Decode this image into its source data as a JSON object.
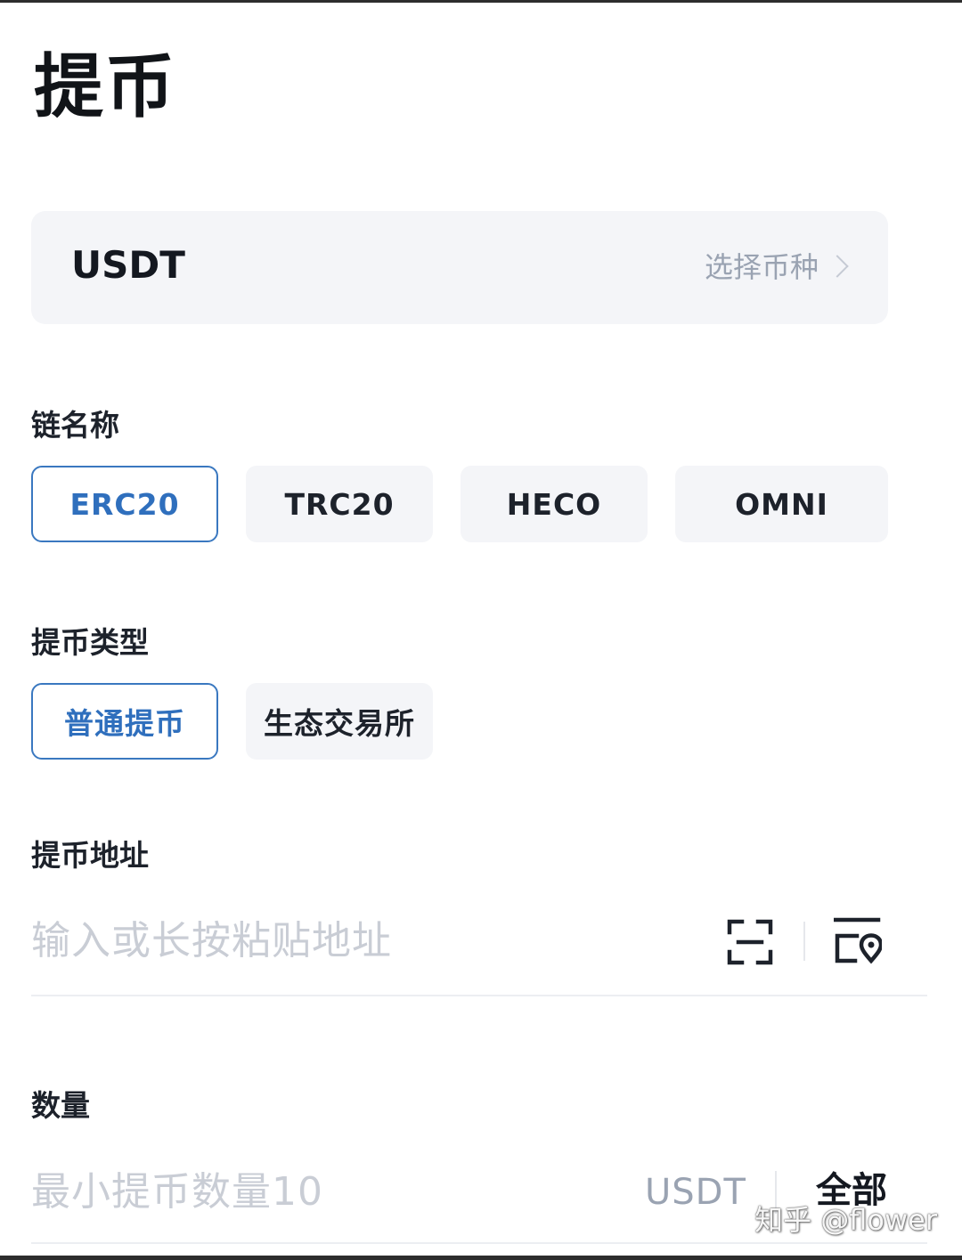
{
  "header": {
    "title": "提币"
  },
  "coin_selector": {
    "coin": "USDT",
    "hint": "选择币种"
  },
  "chain": {
    "label": "链名称",
    "options": [
      "ERC20",
      "TRC20",
      "HECO",
      "OMNI"
    ],
    "selected": "ERC20"
  },
  "withdraw_type": {
    "label": "提币类型",
    "options": [
      "普通提币",
      "生态交易所"
    ],
    "selected": "普通提币"
  },
  "address": {
    "label": "提币地址",
    "placeholder": "输入或长按粘贴地址"
  },
  "amount": {
    "label": "数量",
    "placeholder": "最小提币数量10",
    "unit": "USDT",
    "all_label": "全部"
  },
  "watermark": {
    "text": "知乎 @flower"
  },
  "colors": {
    "accent": "#3a78c0",
    "selected_text": "#2f6fbd",
    "option_bg": "#f4f5f8",
    "placeholder": "#c9cdd5",
    "muted": "#9aa3b2"
  }
}
